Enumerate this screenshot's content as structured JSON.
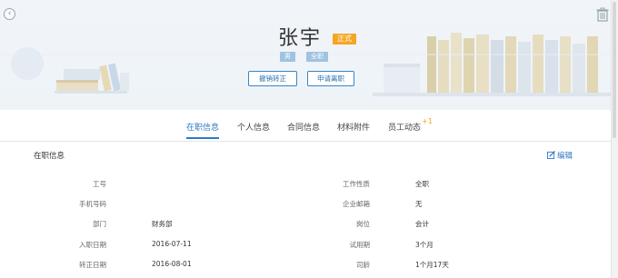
{
  "header": {
    "name": "张宇",
    "status_badge": "正式",
    "tags": {
      "gender": "男",
      "employment_type": "全职"
    },
    "actions": {
      "revoke_regularization": "撤销转正",
      "apply_resignation": "申请离职"
    }
  },
  "tabs": [
    {
      "label": "在职信息",
      "active": true
    },
    {
      "label": "个人信息",
      "active": false
    },
    {
      "label": "合同信息",
      "active": false
    },
    {
      "label": "材料附件",
      "active": false
    },
    {
      "label": "员工动态",
      "active": false,
      "badge": "+1"
    }
  ],
  "section": {
    "title": "在职信息",
    "edit_label": "编辑"
  },
  "fields_left": [
    {
      "label": "工号",
      "value": ""
    },
    {
      "label": "手机号码",
      "value": ""
    },
    {
      "label": "部门",
      "value": "财务部"
    },
    {
      "label": "入职日期",
      "value": "2016-07-11"
    },
    {
      "label": "转正日期",
      "value": "2016-08-01"
    }
  ],
  "fields_right": [
    {
      "label": "工作性质",
      "value": "全职"
    },
    {
      "label": "企业邮箱",
      "value": "无"
    },
    {
      "label": "岗位",
      "value": "会计"
    },
    {
      "label": "试用期",
      "value": "3个月"
    },
    {
      "label": "司龄",
      "value": "1个月17天"
    }
  ],
  "colors": {
    "accent": "#2f78c4",
    "badge_orange": "#f5a623",
    "tag_blue": "#9fc3e0",
    "banner_bg": "#eef3f8"
  },
  "icons": {
    "back": "back-circle-icon",
    "trash": "trash-icon",
    "edit": "edit-icon"
  }
}
